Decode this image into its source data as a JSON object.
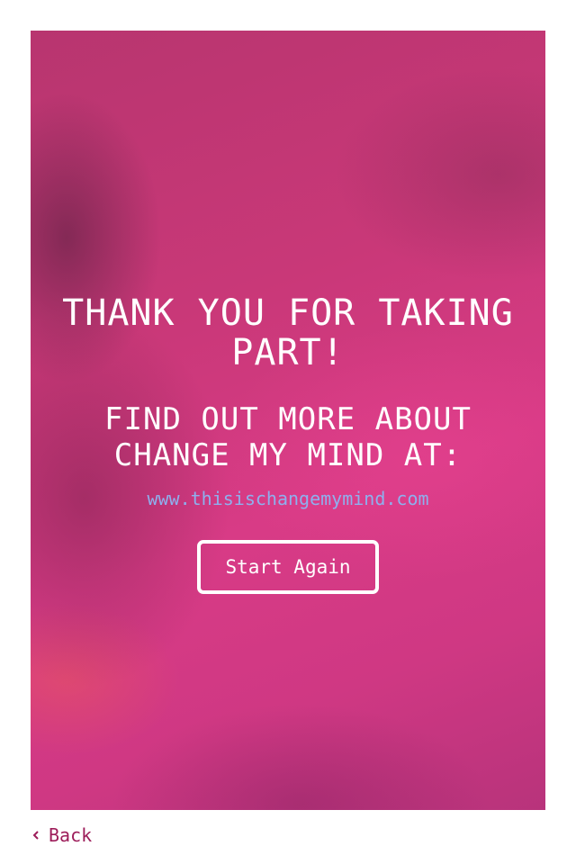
{
  "card": {
    "heading": "THANK YOU FOR TAKING PART!",
    "subheading": "FIND OUT MORE ABOUT CHANGE MY MIND AT:",
    "website": "www.thisischangemymind.com",
    "start_again_label": "Start Again"
  },
  "footer": {
    "back_label": "Back",
    "back_icon": "chevron-left-icon"
  },
  "colors": {
    "card_background": "#d03a82",
    "heading_text": "#ffffff",
    "link_text": "#8eb0ee",
    "back_text": "#9d1d5a"
  }
}
